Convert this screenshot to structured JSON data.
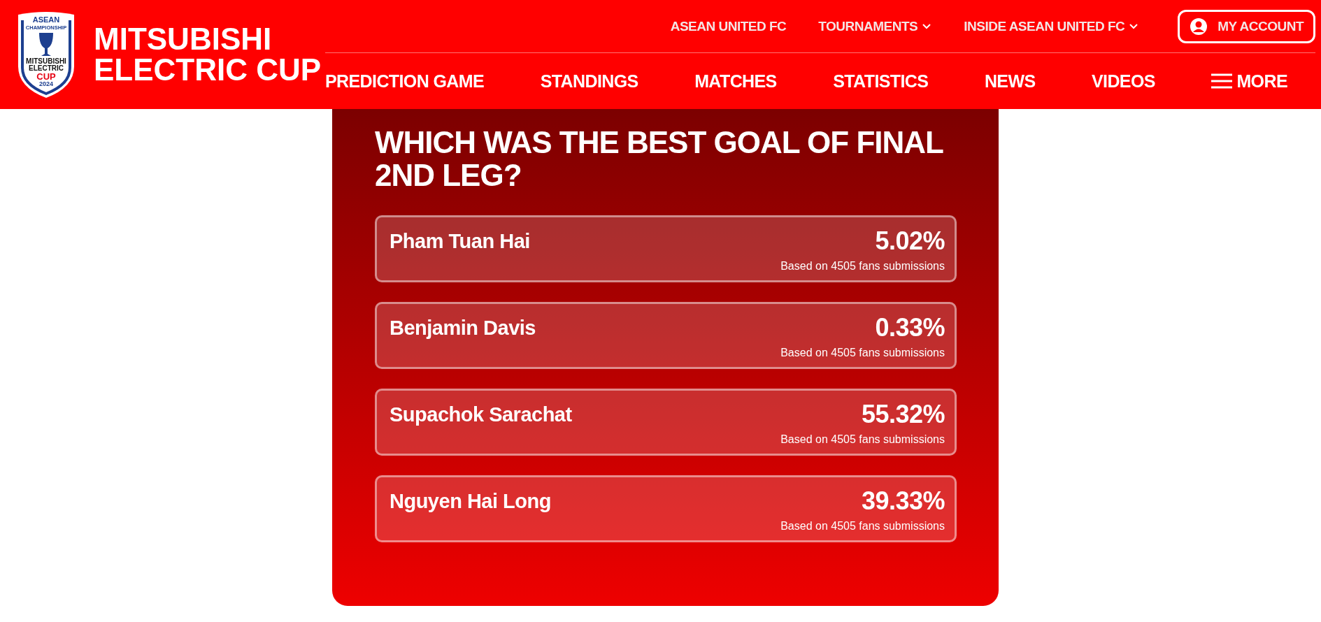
{
  "logo": {
    "texts": [
      "ASEAN",
      "CHAMPIONSHIP",
      "MITSUBISHI",
      "ELECTRIC",
      "CUP",
      "2024"
    ]
  },
  "brand": {
    "title_lines": [
      "MITSUBISHI",
      "ELECTRIC CUP"
    ]
  },
  "top_nav": [
    {
      "label": "ASEAN UNITED FC",
      "kind": "link"
    },
    {
      "label": "TOURNAMENTS",
      "kind": "dropdown"
    },
    {
      "label": "INSIDE ASEAN UNITED FC",
      "kind": "dropdown"
    },
    {
      "label": "MY ACCOUNT",
      "kind": "account"
    }
  ],
  "main_nav": [
    {
      "label": "PREDICTION GAME",
      "kind": "link"
    },
    {
      "label": "STANDINGS",
      "kind": "link"
    },
    {
      "label": "MATCHES",
      "kind": "link"
    },
    {
      "label": "STATISTICS",
      "kind": "link"
    },
    {
      "label": "NEWS",
      "kind": "link"
    },
    {
      "label": "VIDEOS",
      "kind": "link"
    },
    {
      "label": "MORE",
      "kind": "menu"
    }
  ],
  "poll": {
    "question": "WHICH WAS THE BEST GOAL OF FINAL 2ND LEG?",
    "options": [
      {
        "name": "Pham Tuan Hai",
        "percent": "5.02%",
        "note": "Based on 4505 fans submissions"
      },
      {
        "name": "Benjamin Davis",
        "percent": "0.33%",
        "note": "Based on 4505 fans submissions"
      },
      {
        "name": "Supachok Sarachat",
        "percent": "55.32%",
        "note": "Based on 4505 fans submissions"
      },
      {
        "name": "Nguyen Hai Long",
        "percent": "39.33%",
        "note": "Based on 4505 fans submissions"
      }
    ]
  }
}
